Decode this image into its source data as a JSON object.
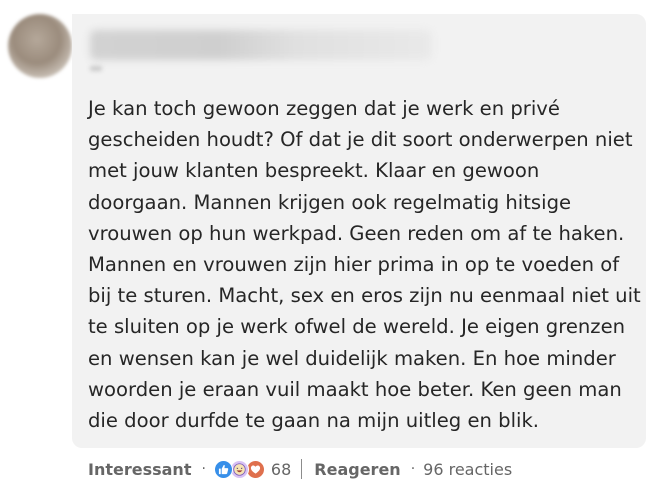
{
  "comment": {
    "lines": [
      "Je kan toch gewoon zeggen dat je werk en privé",
      "gescheiden houdt? Of dat je dit soort onderwerpen niet",
      "met jouw klanten bespreekt. Klaar en gewoon",
      "doorgaan. Mannen krijgen ook regelmatig hitsige",
      "vrouwen op hun werkpad. Geen reden om af te haken.",
      "Mannen en vrouwen zijn hier prima in op te voeden of",
      "bij te sturen. Macht, sex en eros zijn nu eenmaal niet uit",
      "te sluiten op je werk ofwel de wereld. Je eigen grenzen",
      "en wensen kan je wel duidelijk maken. En hoe minder",
      "woorden je eraan vuil maakt hoe beter. Ken geen man",
      "die door durfde te gaan na mijn uitleg en blik."
    ]
  },
  "actions": {
    "reaction_label": "Interessant",
    "separator": "·",
    "reaction_count": "68",
    "reply_label": "Reageren",
    "replies_text": "96 reacties",
    "reaction_icons": [
      "thumbs-up-icon",
      "laughing-face-icon",
      "heart-icon"
    ]
  },
  "colors": {
    "bubble_bg": "#f2f2f2",
    "like": "#378fe9",
    "funny": "#d8c1f4",
    "love": "#df704d",
    "muted_text": "#666666",
    "body_text": "#262626"
  }
}
